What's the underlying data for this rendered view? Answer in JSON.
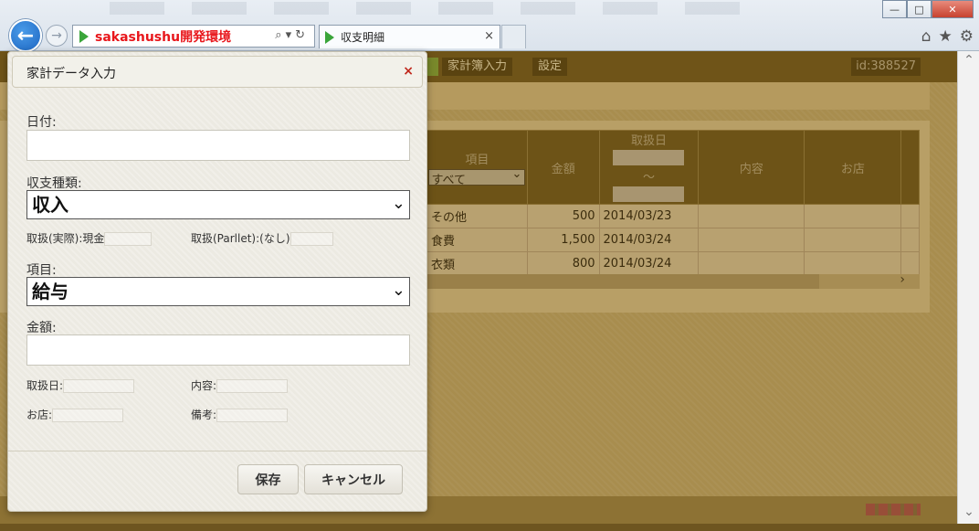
{
  "browser": {
    "address_site": "sakashushu開発環境",
    "tab_title": "収支明細",
    "tab_close": "×",
    "window_buttons": {
      "minimize": "—",
      "maximize": "□",
      "close": "✕"
    },
    "icons": {
      "back": "←",
      "forward": "→",
      "home": "⌂",
      "favorites": "★",
      "settings": "⚙",
      "search": "⌕",
      "dropdown": "▾",
      "refresh": "↻"
    }
  },
  "page": {
    "nav": {
      "kakeibo_input": "家計簿入力",
      "settings": "設定",
      "user_id": "id:388527"
    },
    "table": {
      "headers": {
        "item": "項目",
        "item_filter": "すべて",
        "amount": "金額",
        "date": "取扱日",
        "date_sep": "～",
        "content": "内容",
        "shop": "お店"
      },
      "rows": [
        {
          "item": "その他",
          "amount": "500",
          "date": "2014/03/23"
        },
        {
          "item": "食費",
          "amount": "1,500",
          "date": "2014/03/24"
        },
        {
          "item": "衣類",
          "amount": "800",
          "date": "2014/03/24"
        }
      ],
      "scroll_arrow": "›"
    },
    "scroll": {
      "up": "⌃",
      "down": "⌄"
    }
  },
  "modal": {
    "title": "家計データ入力",
    "close": "×",
    "date_label": "日付:",
    "date_value": "",
    "type_label": "収支種類:",
    "type_value": "収入",
    "handling_actual_label": "取扱(実際):",
    "handling_actual_value": "現金",
    "handling_parllet_label": "取扱(Parllet):",
    "handling_parllet_value": "(なし)",
    "item_label": "項目:",
    "item_value": "給与",
    "amount_label": "金額:",
    "amount_value": "",
    "handled_date_label": "取扱日:",
    "content_label": "内容:",
    "shop_label": "お店:",
    "notes_label": "備考:",
    "save_button": "保存",
    "cancel_button": "キャンセル"
  }
}
